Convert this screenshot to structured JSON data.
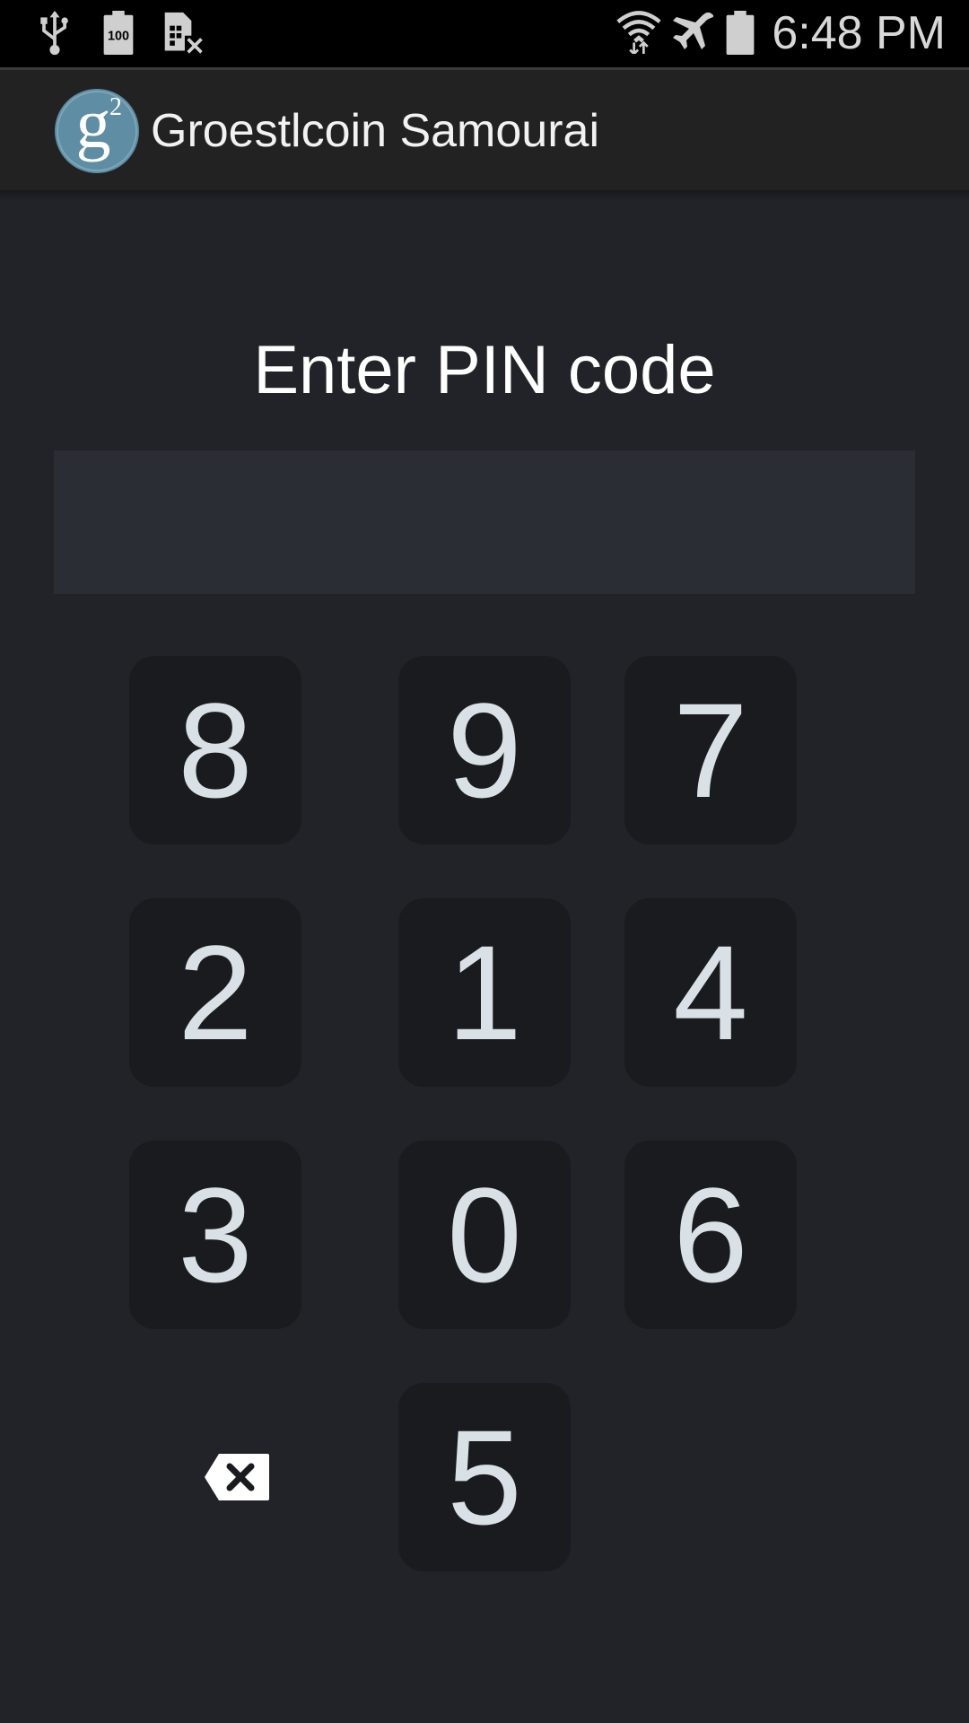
{
  "status_bar": {
    "time": "6:48 PM",
    "battery_level_label": "100",
    "icons": [
      "usb-icon",
      "battery-full-icon",
      "no-sim-icon",
      "wifi-icon",
      "airplane-mode-icon",
      "battery-icon"
    ]
  },
  "app_bar": {
    "title": "Groestlcoin Samourai",
    "logo_text": "g",
    "logo_superscript": "2"
  },
  "pin": {
    "prompt": "Enter PIN code",
    "value": ""
  },
  "keypad": {
    "rows": [
      [
        "8",
        "9",
        "7"
      ],
      [
        "2",
        "1",
        "4"
      ],
      [
        "3",
        "0",
        "6"
      ],
      [
        "5"
      ]
    ],
    "backspace_icon": "backspace-icon"
  },
  "colors": {
    "background": "#212328",
    "status_bar": "#000000",
    "action_bar": "#222222",
    "key_background": "#1a1b1e",
    "key_digit": "#d9e1e6",
    "pin_field": "#2a2d34",
    "logo_circle": "#5f8da3"
  }
}
